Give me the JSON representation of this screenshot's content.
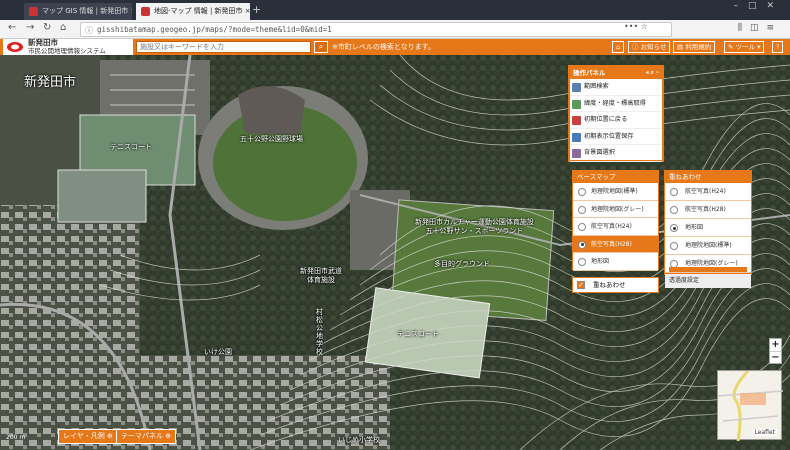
{
  "browser": {
    "tabs": [
      {
        "label": "マップ GIS 情報 | 新発田市 ×"
      },
      {
        "label": "地図-マップ 情報 | 新発田市 ×"
      }
    ],
    "url": "gisshibatamap.geogeo.jp/maps/?mode=theme&lid=0&mid=1"
  },
  "header": {
    "logo_line1": "新発田市",
    "logo_line2": "市民公開地理情報システム",
    "search_placeholder": "施設又はキーワードを入力",
    "note": "※市町レベルの検索となります。",
    "buttons": {
      "notice": "お知らせ",
      "terms": "利用規約",
      "tools": "ツール",
      "help": "?"
    }
  },
  "map": {
    "city_name": "新発田市",
    "labels": {
      "stadium": "五十公野公園野球場",
      "tennis1": "テニスコート",
      "sports_center": "新発田市カルチャー運動公園体育施設\n五十公野サン・スポーツランド",
      "ground": "多目的グラウンド",
      "gym": "新発田市武道\n体育施設",
      "tennis2": "テニスコート",
      "village": "村\n松\n公\n地\n学\n校",
      "park": "いけ公園",
      "school": "いじめ小学校"
    },
    "scale": "200 m",
    "attribution": "Leaflet"
  },
  "panel": {
    "title": "操作パネル",
    "items": [
      {
        "label": "範囲検索",
        "color": "#5b7fb0"
      },
      {
        "label": "緯度・経度・標高取得",
        "color": "#5b9a5b"
      },
      {
        "label": "初期位置に戻る",
        "color": "#c94040"
      },
      {
        "label": "初期表示位置保存",
        "color": "#4a79b9"
      },
      {
        "label": "背景図選択",
        "color": "#8a6a9a"
      }
    ]
  },
  "basemap": {
    "title": "ベースマップ",
    "options": [
      "地理院地図(標準)",
      "地理院地図(グレー)",
      "航空写真(H24)",
      "航空写真(H28)",
      "地形図"
    ],
    "selected": 3
  },
  "overlay": {
    "title": "重ねあわせ",
    "options": [
      "航空写真(H24)",
      "航空写真(H28)",
      "地形図",
      "地理院地図(標準)",
      "地理院地図(グレー)"
    ],
    "selected": 2,
    "transparency_label": "透過度設定",
    "toggle_label": "重ねあわせ"
  },
  "bottom": {
    "layers": "レイヤ・凡例",
    "theme": "テーマパネル"
  }
}
